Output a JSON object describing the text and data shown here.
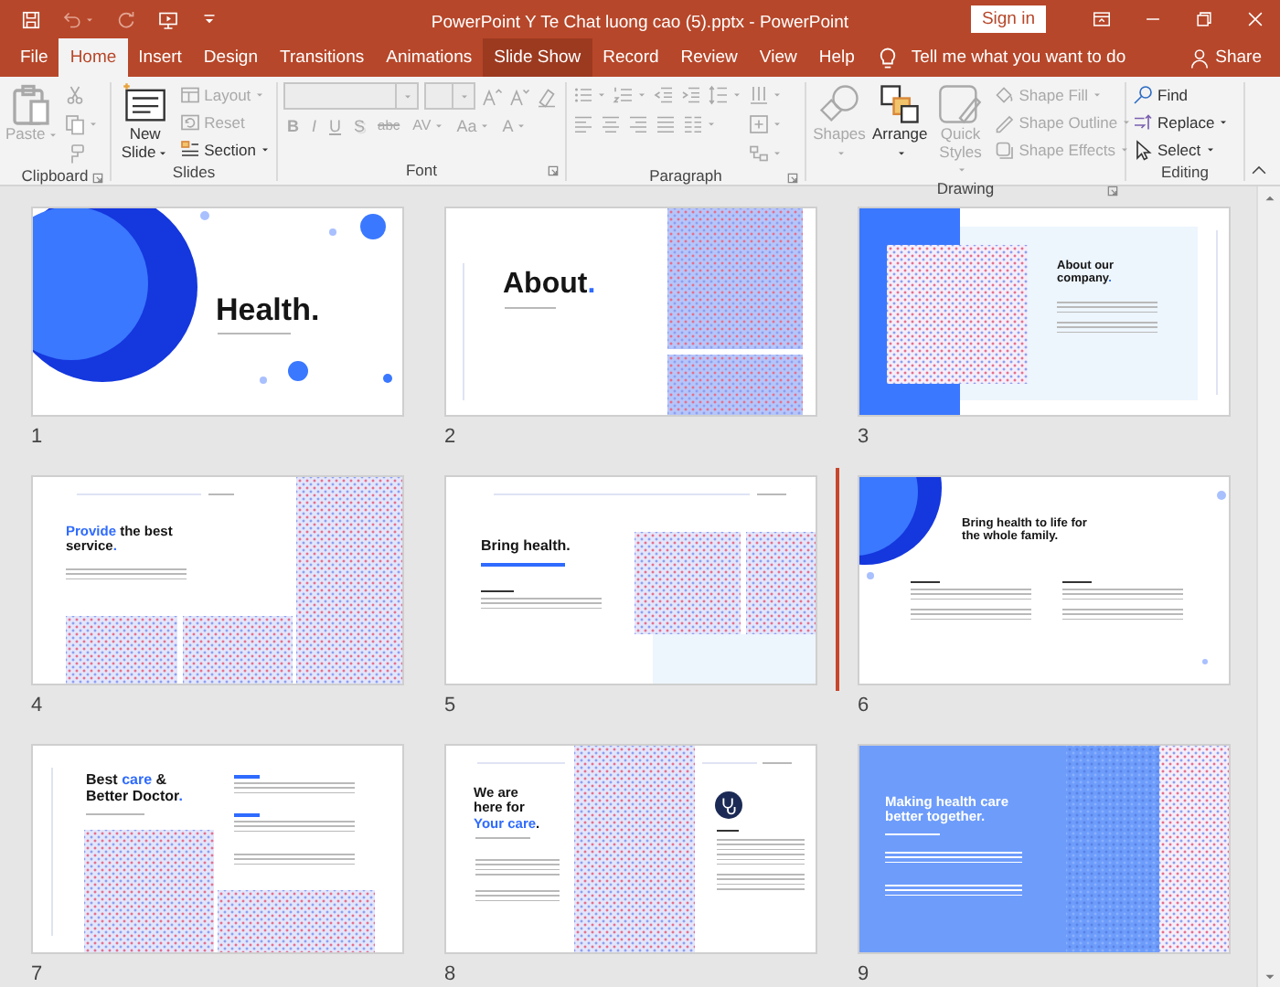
{
  "window": {
    "title": "PowerPoint Y Te Chat luong cao (5).pptx - PowerPoint",
    "sign_in": "Sign in",
    "quick_access": [
      {
        "disabled": false
      },
      {
        "disabled": true
      },
      {
        "disabled": true
      },
      {
        "disabled": false
      }
    ]
  },
  "tabs": [
    {
      "label": "File",
      "selected": false,
      "hovered": false
    },
    {
      "label": "Home",
      "selected": true,
      "hovered": false
    },
    {
      "label": "Insert",
      "selected": false,
      "hovered": false
    },
    {
      "label": "Design",
      "selected": false,
      "hovered": false
    },
    {
      "label": "Transitions",
      "selected": false,
      "hovered": false
    },
    {
      "label": "Animations",
      "selected": false,
      "hovered": false
    },
    {
      "label": "Slide Show",
      "selected": false,
      "hovered": true
    },
    {
      "label": "Record",
      "selected": false,
      "hovered": false
    },
    {
      "label": "Review",
      "selected": false,
      "hovered": false
    },
    {
      "label": "View",
      "selected": false,
      "hovered": false
    },
    {
      "label": "Help",
      "selected": false,
      "hovered": false
    }
  ],
  "tell_me": "Tell me what you want to do",
  "share": "Share",
  "ribbon": [
    {
      "label": "Clipboard",
      "launcher": true,
      "items": [
        {
          "kind": "large",
          "label": "Paste",
          "disabled": true
        },
        {
          "kind": "icon",
          "disabled": true
        },
        {
          "kind": "icon",
          "disabled": true
        },
        {
          "kind": "icon",
          "disabled": true
        }
      ]
    },
    {
      "label": "Slides",
      "launcher": false,
      "items": [
        {
          "kind": "large",
          "label": "New Slide",
          "disabled": false
        },
        {
          "kind": "small",
          "label": "Layout",
          "disabled": true
        },
        {
          "kind": "small",
          "label": "Reset",
          "disabled": true
        },
        {
          "kind": "small",
          "label": "Section",
          "disabled": false
        }
      ]
    },
    {
      "label": "Font",
      "launcher": true,
      "items": [
        {
          "kind": "combo",
          "disabled": true
        },
        {
          "kind": "combo",
          "disabled": true
        },
        {
          "kind": "icon",
          "disabled": true
        },
        {
          "kind": "icon",
          "disabled": true
        },
        {
          "kind": "icon",
          "disabled": true
        },
        {
          "kind": "glyph",
          "label": "B",
          "disabled": true
        },
        {
          "kind": "glyph",
          "label": "I",
          "disabled": true
        },
        {
          "kind": "glyph",
          "label": "U",
          "disabled": true
        },
        {
          "kind": "glyph",
          "label": "S",
          "disabled": true
        },
        {
          "kind": "glyph",
          "label": "abc",
          "disabled": true
        },
        {
          "kind": "glyph",
          "label": "AV",
          "disabled": true
        },
        {
          "kind": "glyph",
          "label": "Aa",
          "disabled": true
        },
        {
          "kind": "glyph",
          "label": "A",
          "disabled": true
        }
      ]
    },
    {
      "label": "Paragraph",
      "launcher": true,
      "items": [
        {
          "kind": "icon",
          "disabled": true
        },
        {
          "kind": "icon",
          "disabled": true
        },
        {
          "kind": "icon",
          "disabled": true
        },
        {
          "kind": "icon",
          "disabled": true
        },
        {
          "kind": "icon",
          "disabled": true
        },
        {
          "kind": "icon",
          "disabled": true
        },
        {
          "kind": "icon",
          "disabled": true
        },
        {
          "kind": "icon",
          "disabled": true
        },
        {
          "kind": "icon",
          "disabled": true
        },
        {
          "kind": "icon",
          "disabled": true
        },
        {
          "kind": "icon",
          "disabled": true
        },
        {
          "kind": "icon",
          "disabled": true
        },
        {
          "kind": "icon",
          "disabled": true
        }
      ]
    },
    {
      "label": "Drawing",
      "launcher": true,
      "items": [
        {
          "kind": "large",
          "label": "Shapes",
          "disabled": true
        },
        {
          "kind": "large",
          "label": "Arrange",
          "disabled": false
        },
        {
          "kind": "large",
          "label": "Quick Styles",
          "disabled": true
        },
        {
          "kind": "small",
          "label": "Shape Fill",
          "disabled": true
        },
        {
          "kind": "small",
          "label": "Shape Outline",
          "disabled": true
        },
        {
          "kind": "small",
          "label": "Shape Effects",
          "disabled": true
        }
      ]
    },
    {
      "label": "Editing",
      "launcher": false,
      "items": [
        {
          "kind": "small",
          "label": "Find",
          "disabled": false
        },
        {
          "kind": "small",
          "label": "Replace",
          "disabled": false
        },
        {
          "kind": "small",
          "label": "Select",
          "disabled": false
        }
      ]
    }
  ],
  "slides": [
    {
      "number": "1",
      "kind": "cover",
      "insert_marker": false,
      "title": [
        {
          "text": "Health.",
          "accent": false
        }
      ]
    },
    {
      "number": "2",
      "kind": "about",
      "insert_marker": false,
      "title": [
        {
          "text": "About",
          "accent": false
        },
        {
          "text": ".",
          "accent": true
        }
      ]
    },
    {
      "number": "3",
      "kind": "company",
      "insert_marker": false,
      "title": [
        {
          "text": "About our\ncompany",
          "accent": false
        },
        {
          "text": ".",
          "accent": true
        }
      ]
    },
    {
      "number": "4",
      "kind": "service",
      "insert_marker": false,
      "title": [
        {
          "text": "Provide",
          "accent": true
        },
        {
          "text": " the best\nservice",
          "accent": false
        },
        {
          "text": ".",
          "accent": true
        }
      ]
    },
    {
      "number": "5",
      "kind": "mission",
      "insert_marker": false,
      "title": [
        {
          "text": "Bring health.",
          "accent": false
        }
      ]
    },
    {
      "number": "6",
      "kind": "family",
      "insert_marker": true,
      "title": [
        {
          "text": "Bring health to life for\nthe whole family.",
          "accent": false
        }
      ]
    },
    {
      "number": "7",
      "kind": "doctor",
      "insert_marker": false,
      "title": [
        {
          "text": "Best ",
          "accent": false
        },
        {
          "text": "care",
          "accent": true
        },
        {
          "text": " &\nBetter Doctor",
          "accent": false
        },
        {
          "text": ".",
          "accent": true
        }
      ]
    },
    {
      "number": "8",
      "kind": "care",
      "insert_marker": false,
      "title": [
        {
          "text": "We are\nhere for\n",
          "accent": false
        },
        {
          "text": "Your care",
          "accent": true
        },
        {
          "text": ".",
          "accent": false
        }
      ]
    },
    {
      "number": "9",
      "kind": "together",
      "insert_marker": false,
      "title": [
        {
          "text": "Making health care\nbetter together.",
          "accent": false
        }
      ]
    }
  ]
}
